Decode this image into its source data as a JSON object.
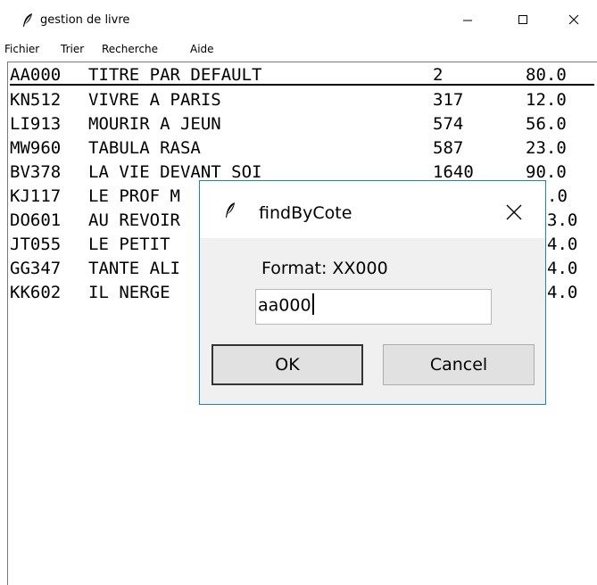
{
  "window": {
    "title": "gestion de livre",
    "icon": "feather-icon"
  },
  "menubar": {
    "items": [
      {
        "label": "Fichier"
      },
      {
        "label": "Trier"
      },
      {
        "label": "Recherche"
      },
      {
        "label": "Aide"
      }
    ]
  },
  "books": [
    {
      "ref": "AA000",
      "title": "TITRE PAR DEFAULT",
      "pages": "2",
      "price": "80.0"
    },
    {
      "ref": "KN512",
      "title": "VIVRE A PARIS",
      "pages": "317",
      "price": "12.0"
    },
    {
      "ref": "LI913",
      "title": "MOURIR A JEUN",
      "pages": "574",
      "price": "56.0"
    },
    {
      "ref": "MW960",
      "title": "TABULA RASA",
      "pages": "587",
      "price": "23.0"
    },
    {
      "ref": "BV378",
      "title": "LA VIE DEVANT SOI",
      "pages": "1640",
      "price": "90.0"
    },
    {
      "ref": "KJ117",
      "title": "LE PROF M",
      "pages": "",
      "price": ".0"
    },
    {
      "ref": "DO601",
      "title": "AU REVOIR",
      "pages": "",
      "price": "3.0"
    },
    {
      "ref": "JT055",
      "title": "LE PETIT",
      "pages": "",
      "price": "4.0"
    },
    {
      "ref": "GG347",
      "title": "TANTE ALI",
      "pages": "",
      "price": "4.0"
    },
    {
      "ref": "KK602",
      "title": "IL NERGE",
      "pages": "",
      "price": "4.0"
    }
  ],
  "dialog": {
    "title": "findByCote",
    "label": "Format: XX000",
    "input_value": "aa000",
    "ok_label": "OK",
    "cancel_label": "Cancel"
  }
}
